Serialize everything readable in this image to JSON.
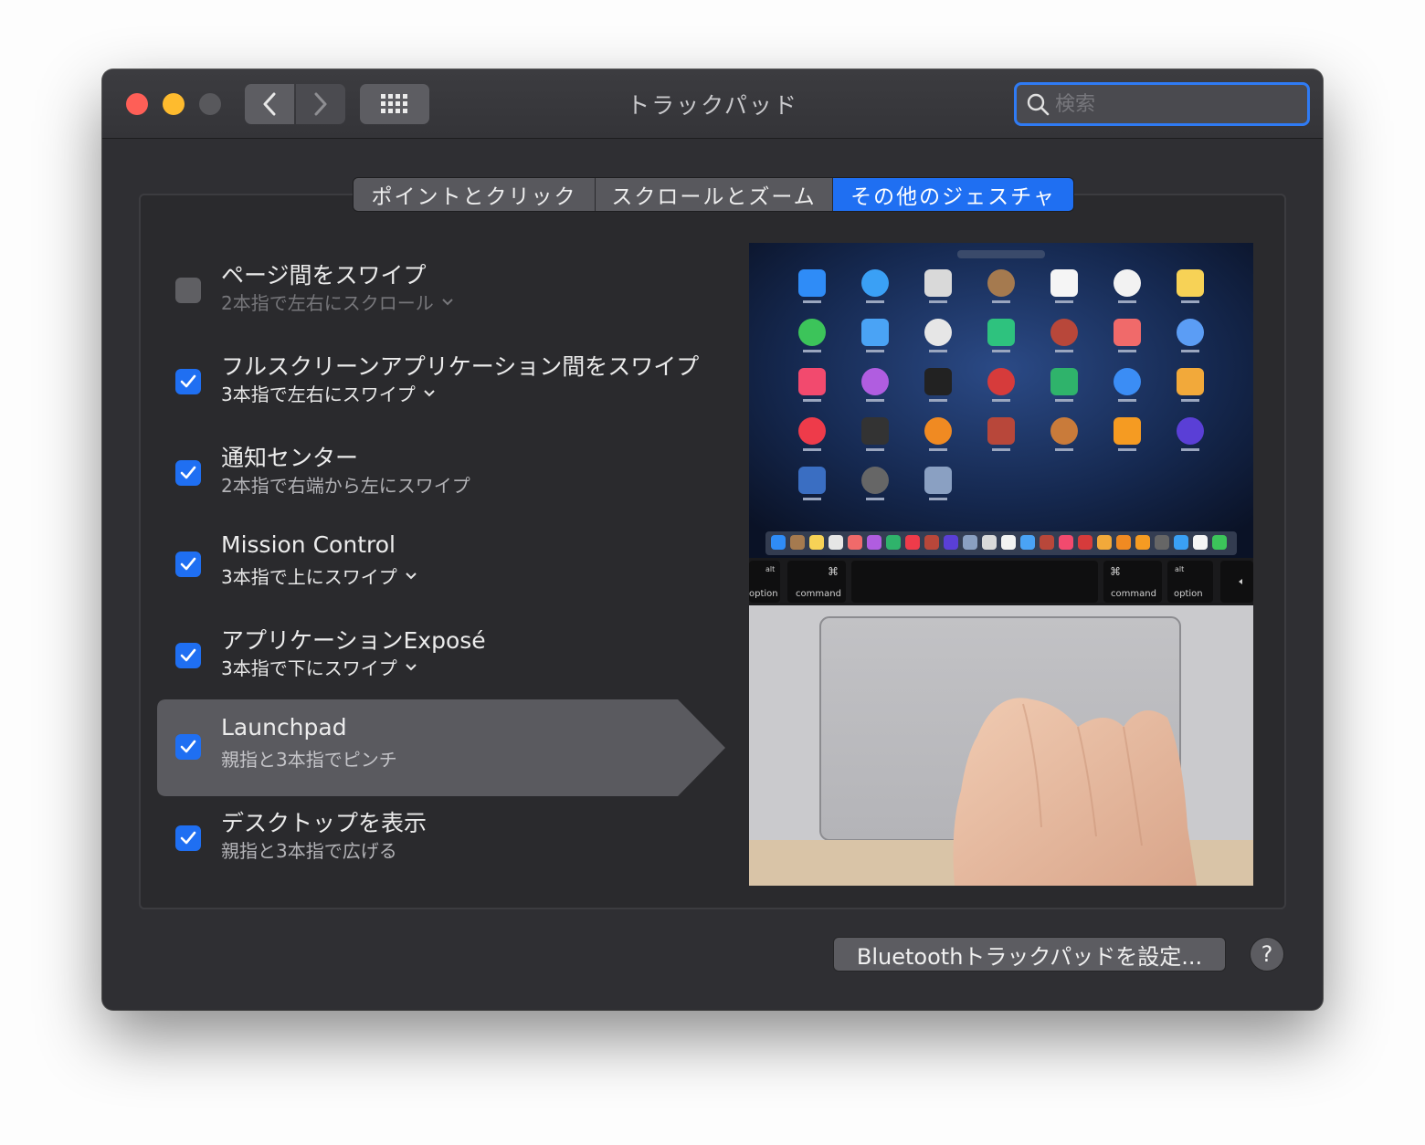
{
  "window": {
    "title": "トラックパッド"
  },
  "search": {
    "placeholder": "検索"
  },
  "tabs": [
    {
      "label": "ポイントとクリック",
      "active": false
    },
    {
      "label": "スクロールとズーム",
      "active": false
    },
    {
      "label": "その他のジェスチャ",
      "active": true
    }
  ],
  "gestures": [
    {
      "title": "ページ間をスワイプ",
      "subtitle": "2本指で左右にスクロール",
      "checked": false,
      "dropdown": true
    },
    {
      "title": "フルスクリーンアプリケーション間をスワイプ",
      "subtitle": "3本指で左右にスワイプ",
      "checked": true,
      "dropdown": true
    },
    {
      "title": "通知センター",
      "subtitle": "2本指で右端から左にスワイプ",
      "checked": true,
      "dropdown": false
    },
    {
      "title": "Mission Control",
      "subtitle": "3本指で上にスワイプ",
      "checked": true,
      "dropdown": true
    },
    {
      "title": "アプリケーションExposé",
      "subtitle": "3本指で下にスワイプ",
      "checked": true,
      "dropdown": true
    },
    {
      "title": "Launchpad",
      "subtitle": "親指と3本指でピンチ",
      "checked": true,
      "dropdown": false,
      "selected": true
    },
    {
      "title": "デスクトップを表示",
      "subtitle": "親指と3本指で広げる",
      "checked": true,
      "dropdown": false
    }
  ],
  "preview": {
    "keys": {
      "left_alt": "alt",
      "left_option": "option",
      "left_cmd_symbol": "⌘",
      "left_command": "command",
      "right_cmd_symbol": "⌘",
      "right_command": "command",
      "right_alt": "alt",
      "right_option": "option"
    }
  },
  "footer": {
    "bluetooth_label": "Bluetoothトラックパッドを設定...",
    "help_label": "?"
  },
  "colors": {
    "accent": "#1f6ff2",
    "window_bg": "#2f2f33",
    "close": "#fe5f57",
    "minimize": "#febb2e"
  }
}
